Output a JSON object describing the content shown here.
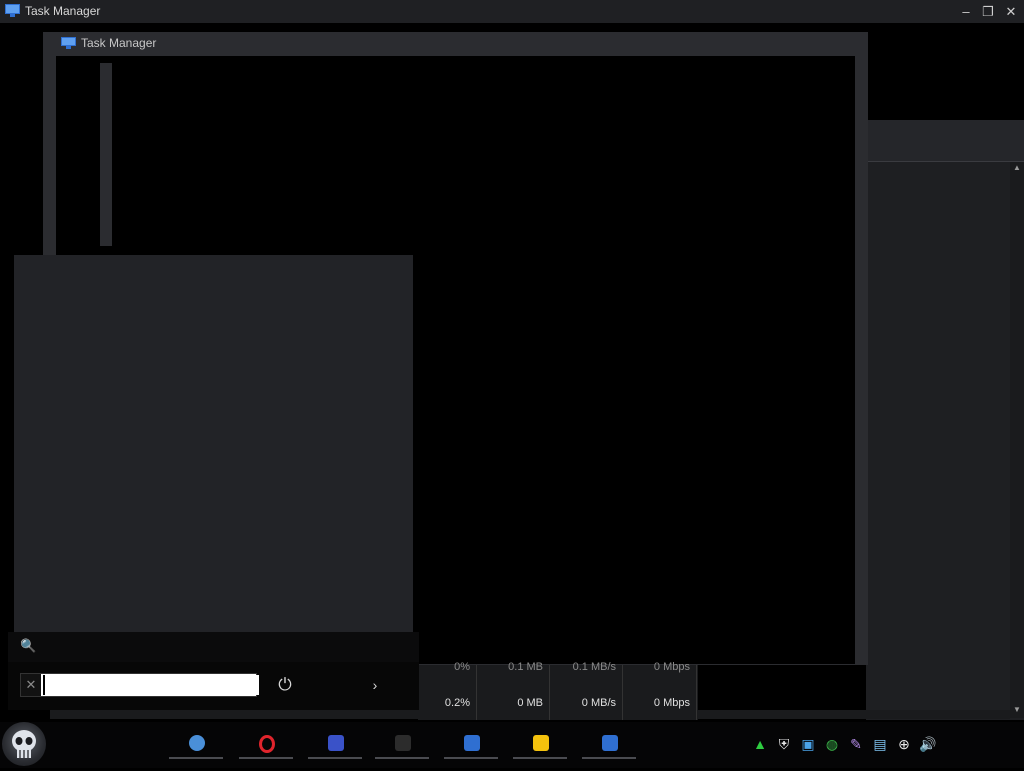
{
  "outer_window": {
    "title": "Task Manager",
    "minimize_symbol": "–",
    "restore_symbol": "❐",
    "close_symbol": "✕"
  },
  "inner_window": {
    "title": "Task Manager"
  },
  "stats": {
    "cpu": {
      "top": "0%",
      "value": "0.2%"
    },
    "memory": {
      "top": "0.1 MB",
      "value": "0 MB"
    },
    "disk": {
      "top": "0.1 MB/s",
      "value": "0 MB/s"
    },
    "network": {
      "top": "0 Mbps",
      "value": "0 Mbps"
    }
  },
  "start_menu": {
    "search_icon": "magnifier-icon",
    "run_input_value": "",
    "clear_symbol": "✕",
    "power_symbol": "⏻",
    "expand_symbol": "›"
  },
  "taskbar": {
    "apps": [
      {
        "name": "settings",
        "color": "#4a8fd8"
      },
      {
        "name": "opera",
        "color": "#e0242c"
      },
      {
        "name": "media-app",
        "color": "#3a52c8"
      },
      {
        "name": "dark-app",
        "color": "#2c2c2c"
      },
      {
        "name": "task-manager",
        "color": "#2f6fd1"
      },
      {
        "name": "store",
        "color": "#f4c20d"
      },
      {
        "name": "task-manager-2",
        "color": "#2f6fd1"
      }
    ],
    "tray": [
      {
        "name": "triangle-icon",
        "symbol": "▲",
        "color": "#2ecc40"
      },
      {
        "name": "shield-icon",
        "symbol": "⛨",
        "color": "#e8e8e8"
      },
      {
        "name": "display-icon",
        "symbol": "▣",
        "color": "#4aa3e8"
      },
      {
        "name": "globe-arrow-icon",
        "symbol": "◍",
        "color": "#3bb54a"
      },
      {
        "name": "feather-icon",
        "symbol": "✎",
        "color": "#b48ce8"
      },
      {
        "name": "monitor-icon",
        "symbol": "▤",
        "color": "#7fc3f0"
      },
      {
        "name": "network-icon",
        "symbol": "⊕",
        "color": "#e8e8e8"
      },
      {
        "name": "volume-icon",
        "symbol": "🔊",
        "color": "#e8e8e8"
      }
    ]
  }
}
